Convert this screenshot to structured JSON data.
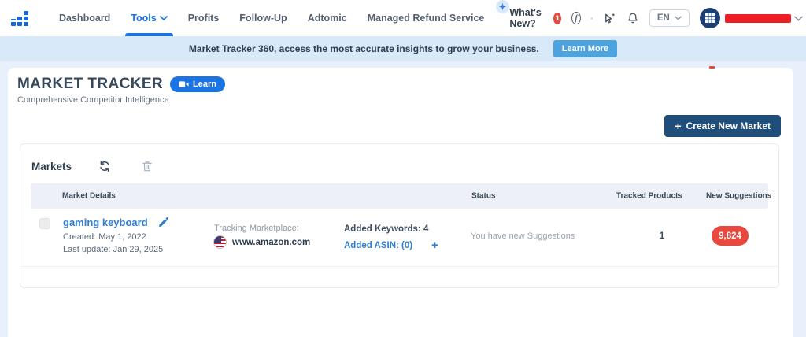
{
  "navbar": {
    "menu": [
      {
        "label": "Dashboard"
      },
      {
        "label": "Tools",
        "active": true
      },
      {
        "label": "Profits"
      },
      {
        "label": "Follow-Up"
      },
      {
        "label": "Adtomic"
      },
      {
        "label": "Managed Refund Service"
      }
    ],
    "whats_new_label": "What's New?",
    "whats_new_badge": "1",
    "language": "EN"
  },
  "banner": {
    "message": "Market Tracker 360, access the most accurate insights to grow your business.",
    "learn_more_label": "Learn More"
  },
  "page": {
    "title": "MARKET TRACKER",
    "learn_label": "Learn",
    "subtitle": "Comprehensive Competitor Intelligence",
    "create_button_label": "Create New Market"
  },
  "markets": {
    "title": "Markets",
    "columns": [
      "Market Details",
      "Status",
      "Tracked Products",
      "New Suggestions"
    ],
    "row": {
      "name": "gaming keyboard",
      "created": "Created: May 1, 2022",
      "last_update": "Last update: Jan 29, 2025",
      "tracking_label": "Tracking Marketplace:",
      "marketplace": "www.amazon.com",
      "added_keywords": "Added Keywords: 4",
      "added_asin": "Added ASIN: (0)",
      "status": "You have new Suggestions",
      "tracked_products": "1",
      "new_suggestions": "9,824"
    }
  },
  "icons": {
    "plus": "+",
    "facebook_f": "f"
  },
  "colors": {
    "accent_blue": "#1b74e4",
    "navy_button": "#1e4e79",
    "banner_bg": "#d8eafa",
    "banner_button": "#4da3dd",
    "badge_red": "#e8483d",
    "redaction_red": "#ee1d23",
    "link_blue": "#2e7ed3"
  }
}
